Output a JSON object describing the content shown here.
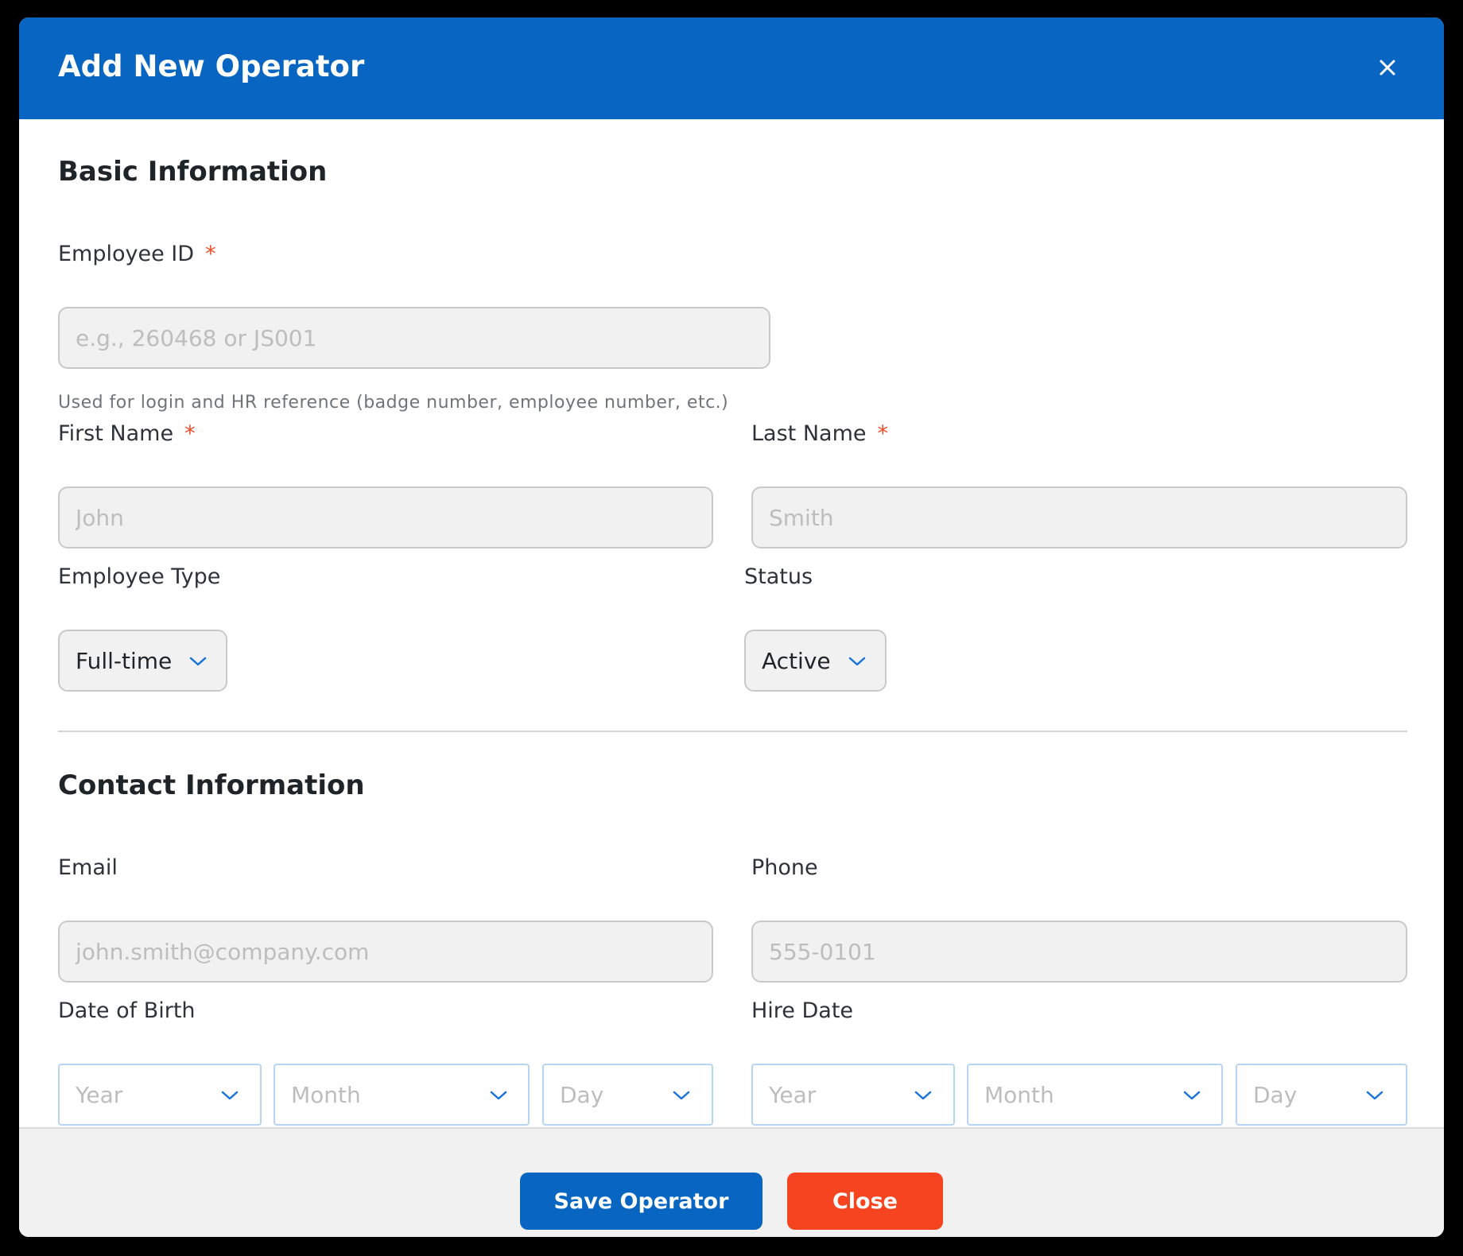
{
  "dialog": {
    "title": "Add New Operator",
    "close_icon": "close-icon"
  },
  "basic_info": {
    "heading": "Basic Information",
    "employee_id": {
      "label": "Employee ID",
      "required_marker": "*",
      "placeholder": "e.g., 260468 or JS001",
      "value": "",
      "help": "Used for login and HR reference (badge number, employee number, etc.)"
    },
    "first_name": {
      "label": "First Name",
      "required_marker": "*",
      "placeholder": "John",
      "value": ""
    },
    "last_name": {
      "label": "Last Name",
      "required_marker": "*",
      "placeholder": "Smith",
      "value": ""
    },
    "employee_type": {
      "label": "Employee Type",
      "selected": "Full-time"
    },
    "status": {
      "label": "Status",
      "selected": "Active"
    }
  },
  "contact_info": {
    "heading": "Contact Information",
    "email": {
      "label": "Email",
      "placeholder": "john.smith@company.com",
      "value": ""
    },
    "phone": {
      "label": "Phone",
      "placeholder": "555-0101",
      "value": ""
    },
    "date_of_birth": {
      "label": "Date of Birth",
      "year": "Year",
      "month": "Month",
      "day": "Day"
    },
    "hire_date": {
      "label": "Hire Date",
      "year": "Year",
      "month": "Month",
      "day": "Day"
    }
  },
  "footer": {
    "save_label": "Save Operator",
    "close_label": "Close"
  },
  "colors": {
    "header_bg": "#0866c2",
    "primary_button": "#0866c2",
    "danger_button": "#f64320",
    "required_marker": "#f04a28",
    "chevron": "#1a73d9"
  }
}
